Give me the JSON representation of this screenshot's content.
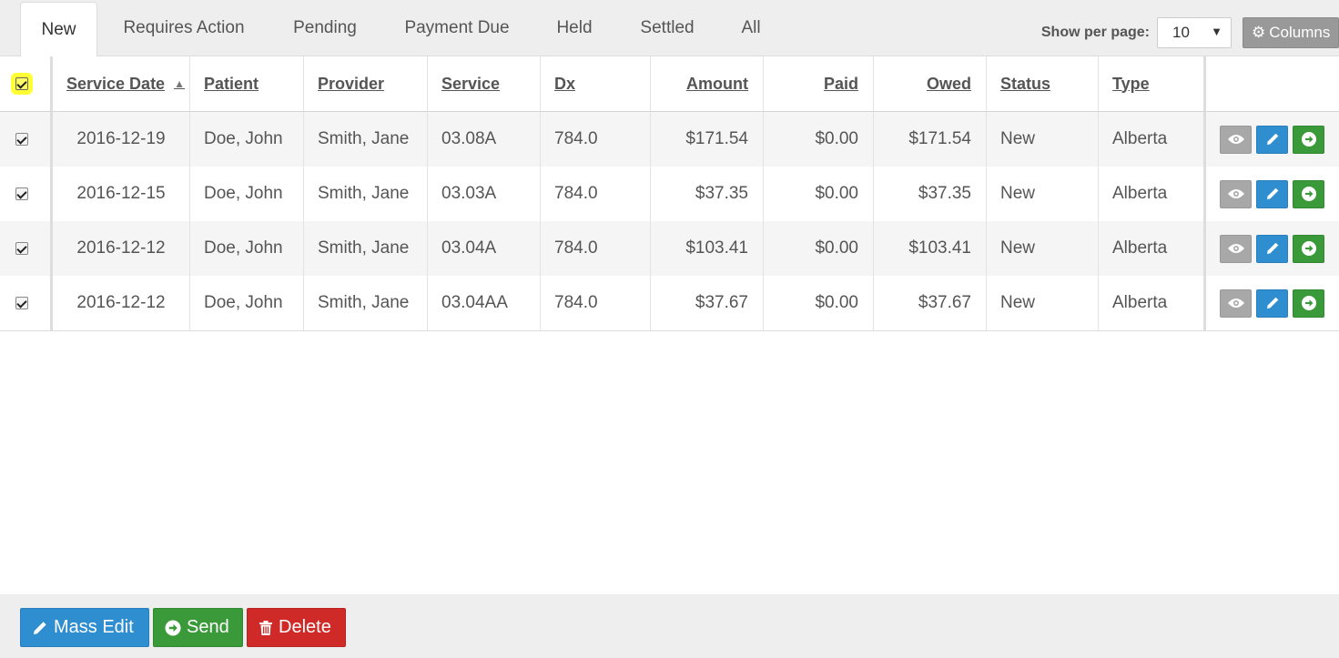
{
  "tabs": [
    {
      "label": "New",
      "active": true
    },
    {
      "label": "Requires Action",
      "active": false
    },
    {
      "label": "Pending",
      "active": false
    },
    {
      "label": "Payment Due",
      "active": false
    },
    {
      "label": "Held",
      "active": false
    },
    {
      "label": "Settled",
      "active": false
    },
    {
      "label": "All",
      "active": false
    }
  ],
  "toolbar": {
    "per_page_label": "Show per page:",
    "per_page_value": "10",
    "columns_label": "Columns"
  },
  "table": {
    "columns": [
      "Service Date",
      "Patient",
      "Provider",
      "Service",
      "Dx",
      "Amount",
      "Paid",
      "Owed",
      "Status",
      "Type"
    ],
    "sort_column": "Service Date",
    "sort_direction": "ascending",
    "select_all_checked": true,
    "rows": [
      {
        "checked": true,
        "service_date": "2016-12-19",
        "patient": "Doe, John",
        "provider": "Smith, Jane",
        "service": "03.08A",
        "dx": "784.0",
        "amount": "$171.54",
        "paid": "$0.00",
        "owed": "$171.54",
        "status": "New",
        "type": "Alberta"
      },
      {
        "checked": true,
        "service_date": "2016-12-15",
        "patient": "Doe, John",
        "provider": "Smith, Jane",
        "service": "03.03A",
        "dx": "784.0",
        "amount": "$37.35",
        "paid": "$0.00",
        "owed": "$37.35",
        "status": "New",
        "type": "Alberta"
      },
      {
        "checked": true,
        "service_date": "2016-12-12",
        "patient": "Doe, John",
        "provider": "Smith, Jane",
        "service": "03.04A",
        "dx": "784.0",
        "amount": "$103.41",
        "paid": "$0.00",
        "owed": "$103.41",
        "status": "New",
        "type": "Alberta"
      },
      {
        "checked": true,
        "service_date": "2016-12-12",
        "patient": "Doe, John",
        "provider": "Smith, Jane",
        "service": "03.04AA",
        "dx": "784.0",
        "amount": "$37.67",
        "paid": "$0.00",
        "owed": "$37.67",
        "status": "New",
        "type": "Alberta"
      }
    ],
    "row_actions": [
      "eye-icon",
      "pencil-icon",
      "arrow-circle-right-icon"
    ]
  },
  "footer": {
    "mass_edit_label": "Mass Edit",
    "send_label": "Send",
    "delete_label": "Delete"
  },
  "colors": {
    "primary_blue": "#2f8ed0",
    "success_green": "#3a9a3a",
    "danger_red": "#cf2a27",
    "neutral_gray": "#a8a8a8",
    "highlight_yellow": "#ffff33"
  }
}
